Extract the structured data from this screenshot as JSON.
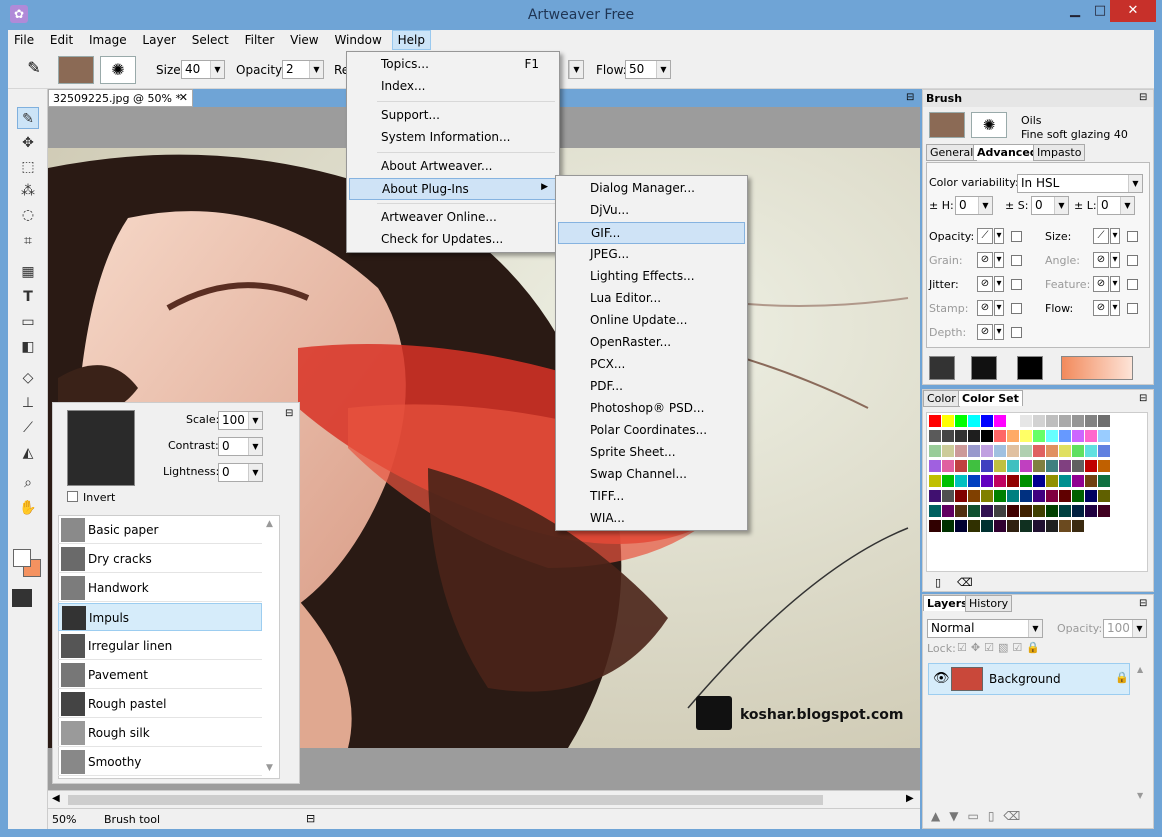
{
  "window": {
    "title": "Artweaver Free"
  },
  "menubar": [
    "File",
    "Edit",
    "Image",
    "Layer",
    "Select",
    "Filter",
    "View",
    "Window",
    "Help"
  ],
  "toolbar": {
    "size_label": "Size:",
    "size_value": "40",
    "opacity_label": "Opacity:",
    "opacity_value": "2",
    "re_label": "Re",
    "flow_label": "Flow:",
    "flow_value": "50"
  },
  "document": {
    "tab": "32509225.jpg @ 50% *",
    "watermark": "koshar.blogspot.com"
  },
  "status": {
    "zoom": "50%",
    "tool": "Brush tool"
  },
  "help_menu": {
    "items": [
      "Topics...",
      "Index...",
      "Support...",
      "System Information...",
      "About Artweaver...",
      "About Plug-Ins",
      "Artweaver Online...",
      "Check for Updates..."
    ],
    "shortcut": "F1"
  },
  "plugins_menu": [
    "Dialog Manager...",
    "DjVu...",
    "GIF...",
    "JPEG...",
    "Lighting Effects...",
    "Lua Editor...",
    "Online Update...",
    "OpenRaster...",
    "PCX...",
    "PDF...",
    "Photoshop® PSD...",
    "Polar Coordinates...",
    "Sprite Sheet...",
    "Swap Channel...",
    "TIFF...",
    "WIA..."
  ],
  "texture_panel": {
    "scale_label": "Scale:",
    "scale_value": "100",
    "contrast_label": "Contrast:",
    "contrast_value": "0",
    "lightness_label": "Lightness:",
    "lightness_value": "0",
    "invert_label": "Invert",
    "items": [
      "Basic paper",
      "Dry cracks",
      "Handwork",
      "Impuls",
      "Irregular linen",
      "Pavement",
      "Rough pastel",
      "Rough silk",
      "Smoothy"
    ],
    "selected": "Impuls"
  },
  "brush_panel": {
    "title": "Brush",
    "category": "Oils",
    "variant": "Fine soft glazing 40",
    "tabs": [
      "General",
      "Advanced",
      "Impasto"
    ],
    "active_tab": "Advanced",
    "color_variability_label": "Color variability:",
    "color_variability_value": "In HSL",
    "h_label": "± H:",
    "h_value": "0",
    "s_label": "± S:",
    "s_value": "0",
    "l_label": "± L:",
    "l_value": "0",
    "left_labels": [
      "Opacity:",
      "Grain:",
      "Jitter:",
      "Stamp:",
      "Depth:"
    ],
    "right_labels": [
      "Size:",
      "Angle:",
      "Feature:",
      "Flow:"
    ]
  },
  "color_panel": {
    "tabs": [
      "Color",
      "Color Set"
    ],
    "active": "Color Set",
    "swatch_colors": [
      "#ff0000",
      "#ffff00",
      "#00ff00",
      "#00ffff",
      "#0000ff",
      "#ff00ff",
      "#ffffff",
      "#e6e6e6",
      "#d2d2d2",
      "#bebebe",
      "#aaaaaa",
      "#969696",
      "#828282",
      "#6e6e6e",
      "#5a5a5a",
      "#464646",
      "#323232",
      "#1e1e1e",
      "#000000",
      "#ff6666",
      "#ffaa66",
      "#ffff66",
      "#66ff66",
      "#66ffff",
      "#6699ff",
      "#cc66ff",
      "#ff66cc",
      "#99ccff",
      "#99cc99",
      "#cccc99",
      "#cc9999",
      "#9999cc",
      "#c0a0e0",
      "#a0c0e0",
      "#e0c0a0",
      "#b0d0b0",
      "#e06060",
      "#e09060",
      "#e0e060",
      "#60e060",
      "#60e0e0",
      "#6080e0",
      "#a060e0",
      "#e060a0",
      "#c04040",
      "#40c040",
      "#4040c0",
      "#c0c040",
      "#40c0c0",
      "#c040c0",
      "#808040",
      "#408080",
      "#804080",
      "#606060",
      "#c00000",
      "#c06000",
      "#c0c000",
      "#00c000",
      "#00c0c0",
      "#0040c0",
      "#6000c0",
      "#c00060",
      "#900000",
      "#009000",
      "#000090",
      "#909000",
      "#009090",
      "#900090",
      "#704010",
      "#107040",
      "#401070",
      "#505050",
      "#800000",
      "#804000",
      "#808000",
      "#008000",
      "#008080",
      "#003080",
      "#400080",
      "#800040",
      "#600000",
      "#006000",
      "#000060",
      "#606000",
      "#006060",
      "#600060",
      "#503010",
      "#105030",
      "#301050",
      "#404040",
      "#400000",
      "#402000",
      "#404000",
      "#004000",
      "#004040",
      "#002040",
      "#200040",
      "#400020",
      "#300000",
      "#003000",
      "#000030",
      "#303000",
      "#003030",
      "#300030",
      "#302010",
      "#103020",
      "#201030",
      "#202020",
      "#6b4a1f",
      "#3a2a10"
    ]
  },
  "layers_panel": {
    "tabs": [
      "Layers",
      "History"
    ],
    "active": "Layers",
    "mode": "Normal",
    "opacity_label": "Opacity:",
    "opacity_value": "100",
    "lock_label": "Lock:",
    "layer_name": "Background"
  }
}
